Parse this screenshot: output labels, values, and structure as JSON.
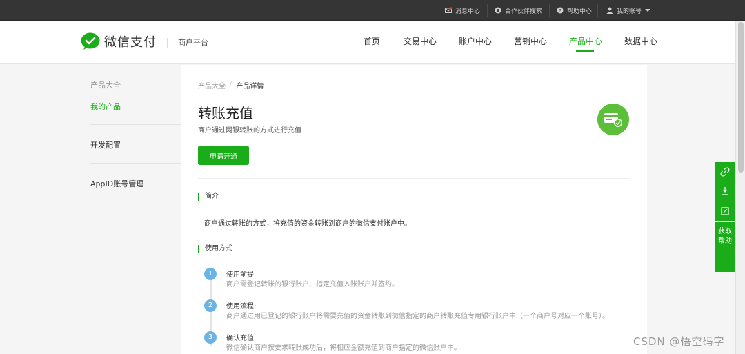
{
  "topbar": {
    "messages": "消息中心",
    "partner_search": "合作伙伴搜索",
    "help": "帮助中心",
    "account": "我的账号"
  },
  "header": {
    "logo_text": "微信支付",
    "platform": "商户平台",
    "nav": [
      "首页",
      "交易中心",
      "账户中心",
      "营销中心",
      "产品中心",
      "数据中心"
    ],
    "active_nav": "产品中心"
  },
  "sidebar": {
    "items": [
      "产品大全",
      "我的产品",
      "开发配置",
      "AppID账号管理"
    ]
  },
  "breadcrumb": {
    "root": "产品大全",
    "separator": "/",
    "current": "产品详情"
  },
  "product": {
    "title": "转账充值",
    "description": "商户通过网银转账的方式进行充值",
    "apply_label": "申请开通"
  },
  "sections": {
    "intro_title": "简介",
    "intro_text": "商户通过转账的方式，将充值的资金转账到商户的微信支付账户中。",
    "usage_title": "使用方式"
  },
  "steps": [
    {
      "num": "1",
      "title": "使用前提",
      "desc": "商户需登记转账的银行账户、指定充值入账账户并签约。"
    },
    {
      "num": "2",
      "title": "使用流程:",
      "desc": "商户通过用已登记的银行账户将需要充值的资金转账到微信指定的商户转账充值专用银行账户中（一个商户号对应一个账号）。"
    },
    {
      "num": "3",
      "title": "确认充值",
      "desc": "微信确认商户按要求转账成功后，将相应金额充值到商户指定的微信账户中。"
    }
  ],
  "float_help": "获取帮助",
  "watermark": "CSDN @悟空码字",
  "colors": {
    "brand_green": "#1aad19",
    "topbar": "#353535",
    "step_blue": "#68b4e6"
  }
}
